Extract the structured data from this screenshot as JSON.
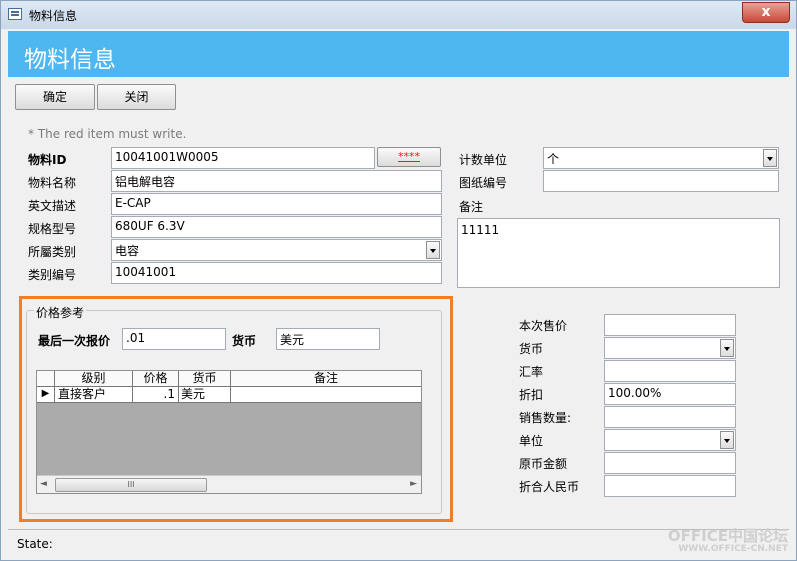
{
  "window": {
    "title": "物料信息",
    "close_glyph": "x"
  },
  "header": {
    "title": "物料信息"
  },
  "toolbar": {
    "ok_label": "确定",
    "close_label": "关闭"
  },
  "hint": "* The red item must write.",
  "form": {
    "material_id": {
      "label": "物料ID",
      "value": "10041001W0005",
      "button_label": "****"
    },
    "material_name": {
      "label": "物料名称",
      "value": "铝电解电容"
    },
    "english_desc": {
      "label": "英文描述",
      "value": "E-CAP"
    },
    "spec_model": {
      "label": "规格型号",
      "value": "680UF 6.3V"
    },
    "category": {
      "label": "所屬类别",
      "value": "电容"
    },
    "category_code": {
      "label": "类别编号",
      "value": "10041001"
    },
    "unit": {
      "label": "计数单位",
      "value": "个"
    },
    "drawing_no": {
      "label": "图纸编号",
      "value": ""
    },
    "remark": {
      "label": "备注",
      "value": "11111"
    }
  },
  "price_ref": {
    "group_title": "价格参考",
    "last_quote_label": "最后一次报价",
    "last_quote_value": ".01",
    "currency_label": "货币",
    "currency_value": "美元",
    "grid": {
      "columns": [
        "级别",
        "价格",
        "货币",
        "备注"
      ],
      "rows": [
        {
          "level": "直接客户",
          "price": ".1",
          "currency": "美元",
          "note": ""
        }
      ],
      "row_selector": "▶",
      "scroll_left": "◄",
      "scroll_right": "►",
      "scroll_thumb": "III"
    }
  },
  "sale": {
    "this_price": {
      "label": "本次售价",
      "value": ""
    },
    "currency": {
      "label": "货币",
      "value": ""
    },
    "rate": {
      "label": "汇率",
      "value": ""
    },
    "discount": {
      "label": "折扣",
      "value": "100.00%"
    },
    "quantity": {
      "label": "销售数量:",
      "value": ""
    },
    "unit": {
      "label": "单位",
      "value": ""
    },
    "orig_amount": {
      "label": "原币金额",
      "value": ""
    },
    "rmb_amount": {
      "label": "折合人民币",
      "value": ""
    }
  },
  "status": {
    "label": "State:"
  },
  "watermark": {
    "line1": "OFFICE中国论坛",
    "line2": "WWW.OFFICE-CN.NET"
  }
}
